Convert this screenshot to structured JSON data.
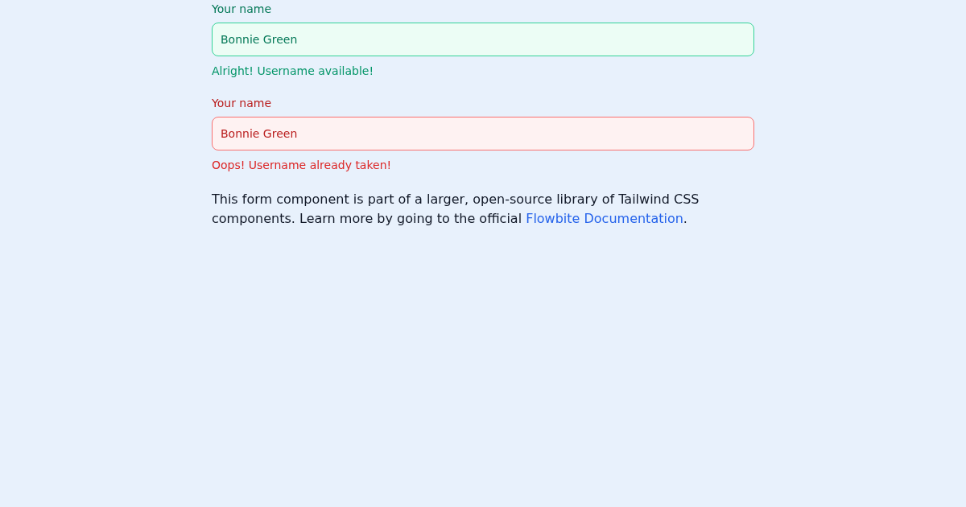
{
  "fields": [
    {
      "label": "Your name",
      "value": "Bonnie Green",
      "invalid": false,
      "message": "Alright! Username available!"
    },
    {
      "label": "Your name",
      "value": "Bonnie Green",
      "invalid": true,
      "message": "Oops! Username already taken!"
    }
  ],
  "note": {
    "text": "This form component is part of a larger, open-source library of Tailwind CSS components. Learn more by going to the official ",
    "link": "Flowbite Documentation",
    "after": "."
  }
}
